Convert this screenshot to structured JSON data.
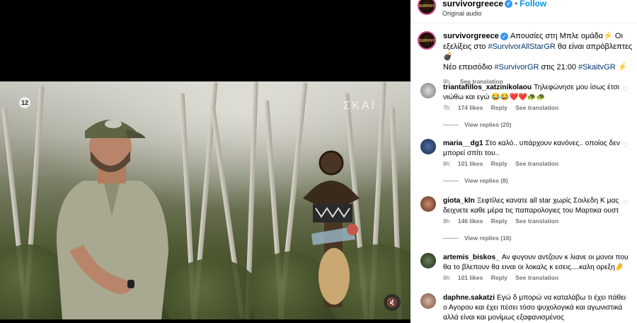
{
  "video": {
    "channel_badge": "12",
    "channel_name": "ΣΚΑΪ"
  },
  "header": {
    "username": "survivorgreece",
    "follow_label": "Follow",
    "audio_label": "Original audio",
    "avatar_text": "SURVIVOR"
  },
  "caption": {
    "username": "survivorgreece",
    "text_part1": "Απουσίες στη Μπλε ομάδα⚡ Οι εξελίξεις στο",
    "tag1": "#SurvivorAllStarGR",
    "text_part2": " θα είναι απρόβλεπτες 💣",
    "text_part3": "Νέο επεισόδιο ",
    "tag2": "#SurvivorGR",
    "text_part4": " στις 21:00 ",
    "tag3": "#SkaitvGR",
    "text_part5": " ⚡",
    "time": "8h",
    "see_translation": "See translation"
  },
  "comments": [
    {
      "username": "triantafillos_xatzinikolaou",
      "text": "Τηλεφώνησε μου ίσως έτσι νιώθω και εγώ 😂😂❤️❤️🐢🐢",
      "time": "7h",
      "likes": "174 likes",
      "reply": "Reply",
      "see_translation": "See translation",
      "view_replies": "View replies (20)"
    },
    {
      "username": "maria__dg1",
      "text": "Στο καλό.. υπάρχουν κανόνες.. οποίος δεν μπορεί σπίτι του..",
      "time": "8h",
      "likes": "101 likes",
      "reply": "Reply",
      "see_translation": "See translation",
      "view_replies": "View replies (8)"
    },
    {
      "username": "giota_kln",
      "text": "Ξεφτίλες κανατε all star χωρίς Σοιλεδη Κ μας δειχνετε καθε μέρα τις παπαρολογιες του Μαρτικα ουστ",
      "time": "8h",
      "likes": "146 likes",
      "reply": "Reply",
      "see_translation": "See translation",
      "view_replies": "View replies (16)"
    },
    {
      "username": "artemis_biskos_",
      "text": "Αν φυγουν αντζουν κ λιανε οι μονοι που θα το βλεπουν θα ειναι οι λοκαλς κ εσεις....καλη ορεξη🤌",
      "time": "8h",
      "likes": "101 likes",
      "reply": "Reply",
      "see_translation": "See translation"
    },
    {
      "username": "daphne.sakatzi",
      "text": "Εγώ δ μπορώ να καταλάβω τι έχει πάθει ο Αγορου και έχει πέσει τόσο ψυχολογικά και αγωνιστικά αλλά είναι και μονίμως εξαφανισμένος"
    }
  ],
  "colors": {
    "link": "#00376b",
    "follow": "#0095f6",
    "verified": "#3897f0"
  }
}
